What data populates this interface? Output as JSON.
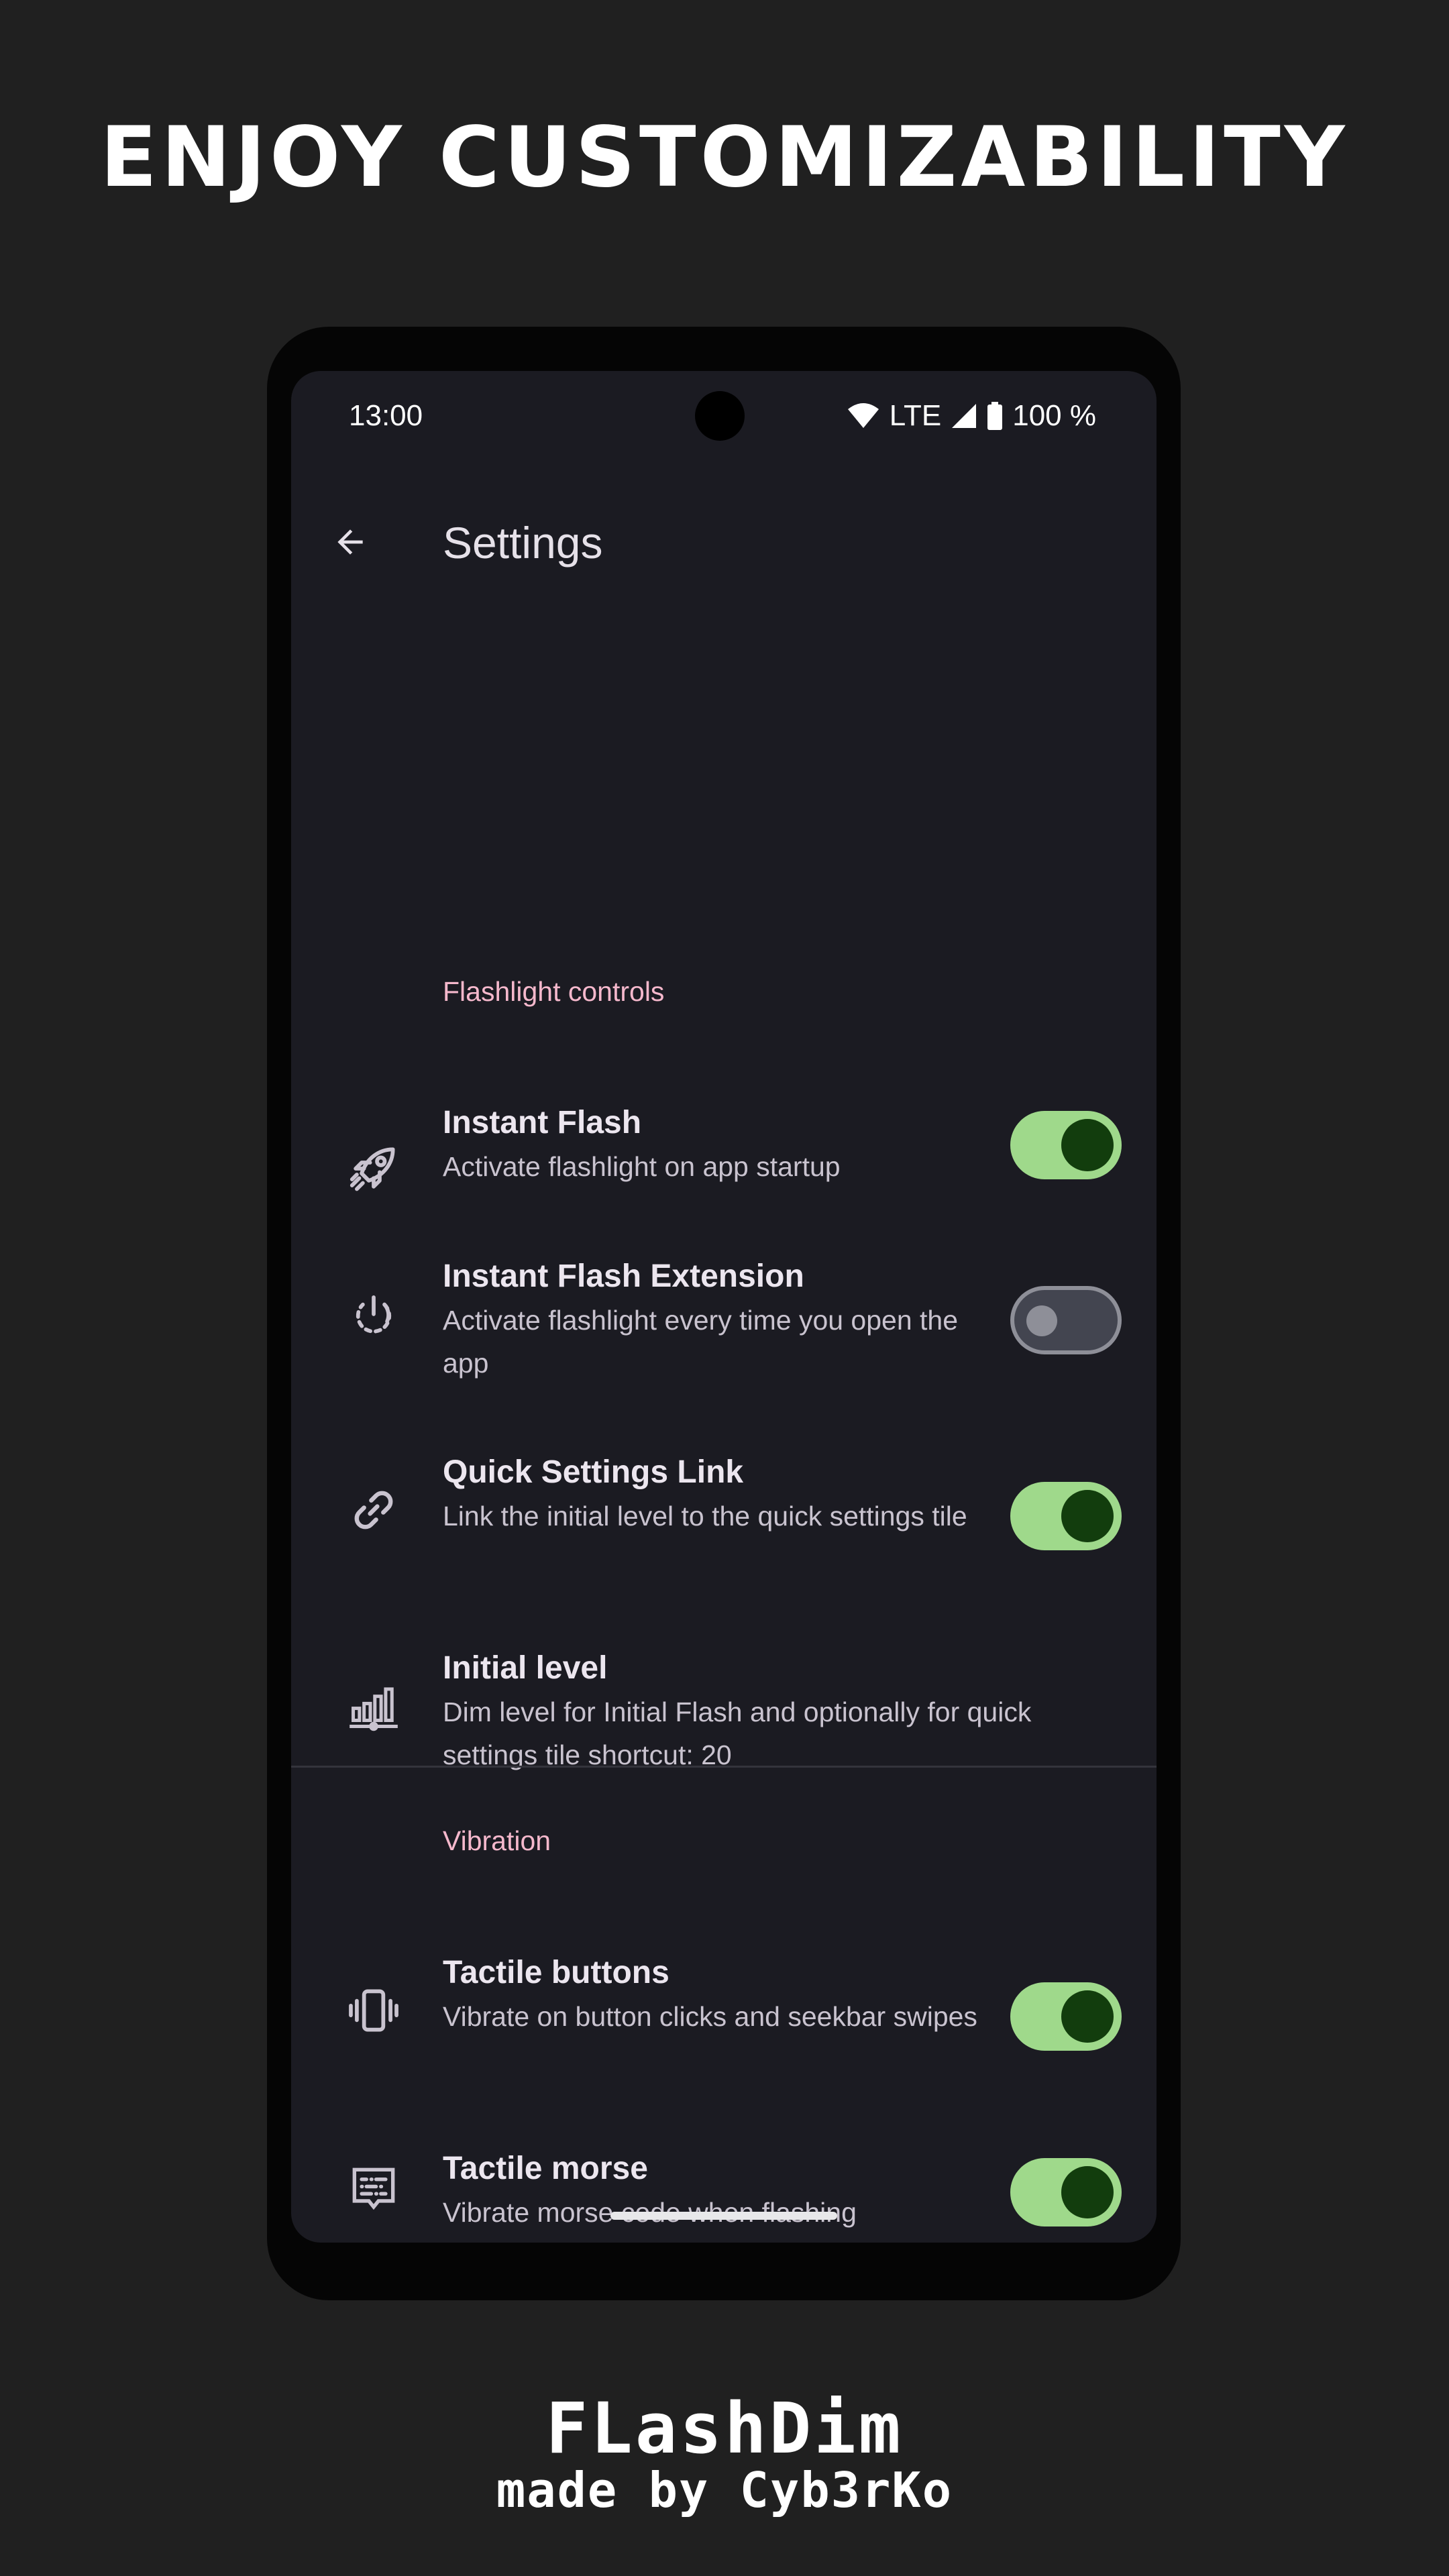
{
  "promo": {
    "headline": "ENJOY CUSTOMIZABILITY",
    "brand_name": "FLashDim",
    "brand_subtitle": "made by Cyb3rKo"
  },
  "status_bar": {
    "time": "13:00",
    "network": "LTE",
    "battery": "100 %",
    "icons": [
      "wifi-icon",
      "cell-signal-icon",
      "battery-icon"
    ]
  },
  "app_bar": {
    "title": "Settings",
    "back_icon": "arrow-back-icon"
  },
  "sections": [
    {
      "header": "Flashlight controls",
      "items": [
        {
          "title": "Instant Flash",
          "summary": "Activate flashlight on app startup",
          "icon": "rocket-icon",
          "switch": true
        },
        {
          "title": "Instant Flash Extension",
          "summary": "Activate flashlight every time you open the app",
          "icon": "power-restart-icon",
          "switch": false
        },
        {
          "title": "Quick Settings Link",
          "summary": "Link the initial level to the quick settings tile",
          "icon": "link-icon",
          "switch": true
        },
        {
          "title": "Initial level",
          "summary": "Dim level for Initial Flash and optionally for quick settings tile shortcut: 20",
          "icon": "bar-chart-icon"
        }
      ]
    },
    {
      "header": "Vibration",
      "items": [
        {
          "title": "Tactile buttons",
          "summary": "Vibrate on button clicks and seekbar swipes",
          "icon": "vibration-icon",
          "switch": true
        },
        {
          "title": "Tactile morse",
          "summary": "Vibrate morse code when flashing",
          "icon": "morse-message-icon",
          "switch": true
        }
      ]
    }
  ],
  "colors": {
    "background": "#202020",
    "screen": "#1b1b22",
    "accent_header": "#f5b8cc",
    "switch_on_track": "#9fd98b",
    "switch_on_thumb": "#123d0d",
    "switch_off_track": "#434550",
    "switch_off_outline": "#8e8f98"
  }
}
